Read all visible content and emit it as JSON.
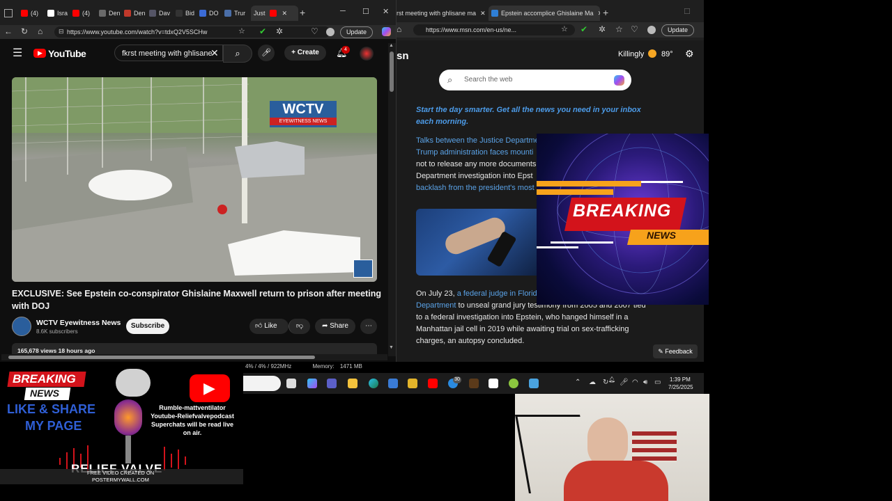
{
  "yt_browser": {
    "tabs": [
      "(4)",
      "Isra",
      "(4)",
      "Den",
      "Den",
      "Dav",
      "Bid",
      "DO",
      "Trur",
      "Just"
    ],
    "url": "https://www.youtube.com/watch?v=tdxQ2V5SCHw",
    "update_label": "Update"
  },
  "youtube": {
    "logo": "YouTube",
    "search_value": "fkrst meeting with ghlisane",
    "create_label": "Create",
    "notif_count": "4",
    "video_watermark_title": "WCTV",
    "video_watermark_sub": "EYEWITNESS NEWS",
    "video_title": "EXCLUSIVE: See Epstein co-conspirator Ghislaine Maxwell return to prison after meeting with DOJ",
    "channel_name": "WCTV Eyewitness News",
    "subscribers": "8.6K subscribers",
    "subscribe_label": "Subscribe",
    "like_label": "Like",
    "share_label": "Share",
    "views_line": "165,678 views  18 hours ago"
  },
  "msn_browser": {
    "tab_inactive": "rst meeting with ghlisane ma",
    "tab_active": "Epstein accomplice Ghislaine Ma",
    "url": "https://www.msn.com/en-us/ne...",
    "update_label": "Update",
    "brand_partial": "sn",
    "location": "Killingly",
    "temp": "89°",
    "search_placeholder": "Search the web",
    "promo": "Start the day smarter. Get all the news you need in your inbox each morning.",
    "para1_link1": "Talks between the Justice Departme",
    "para1_link2": "Trump administration faces mounti",
    "para1_text1": "not to release any more documents",
    "para1_text2": "Department investigation into Epst",
    "para1_link3": "backlash from the president's most",
    "para2_lead": "On July 23, ",
    "para2_link1": "a federal judge in Florid",
    "para2_link2": "Department",
    "para2_text1": " to unseal grand jury testimony from 2005 and 2007 tied",
    "para2_text2": "to a federal investigation into Epstein, who hanged himself in a",
    "para2_text3": "Manhattan jail cell in 2019 while awaiting trial on sex-trafficking",
    "para2_text4": "charges, an autopsy concluded.",
    "feedback_label": "Feedback"
  },
  "breaking_graphic": {
    "line1": "BREAKING",
    "line2": "NEWS"
  },
  "taskbar": {
    "perf": "4% / 4% / 922MHz",
    "memory_label": "Memory:",
    "memory_value": "1471 MB",
    "badge": "30",
    "time": "1:39 PM",
    "date": "7/25/2025"
  },
  "stream_overlay": {
    "breaking": "BREAKING",
    "news": "NEWS",
    "like_share": "LIKE & SHARE",
    "my_page": "MY PAGE",
    "promo_line1": "Rumble-mattventilator",
    "promo_line2": "Youtube-Reliefvalvepodcast",
    "promo_line3": "Superchats will be read live",
    "promo_line4": "on air.",
    "logo_text": "RELIEF VALVE",
    "credit_line1": "FREE VIDEO CREATED ON",
    "credit_line2": "POSTERMYWALL.COM"
  },
  "colors": {
    "yt_red": "#ff0000",
    "msn_link": "#5aa2e6",
    "breaking_red": "#d3131b",
    "breaking_orange": "#f7a21b"
  }
}
